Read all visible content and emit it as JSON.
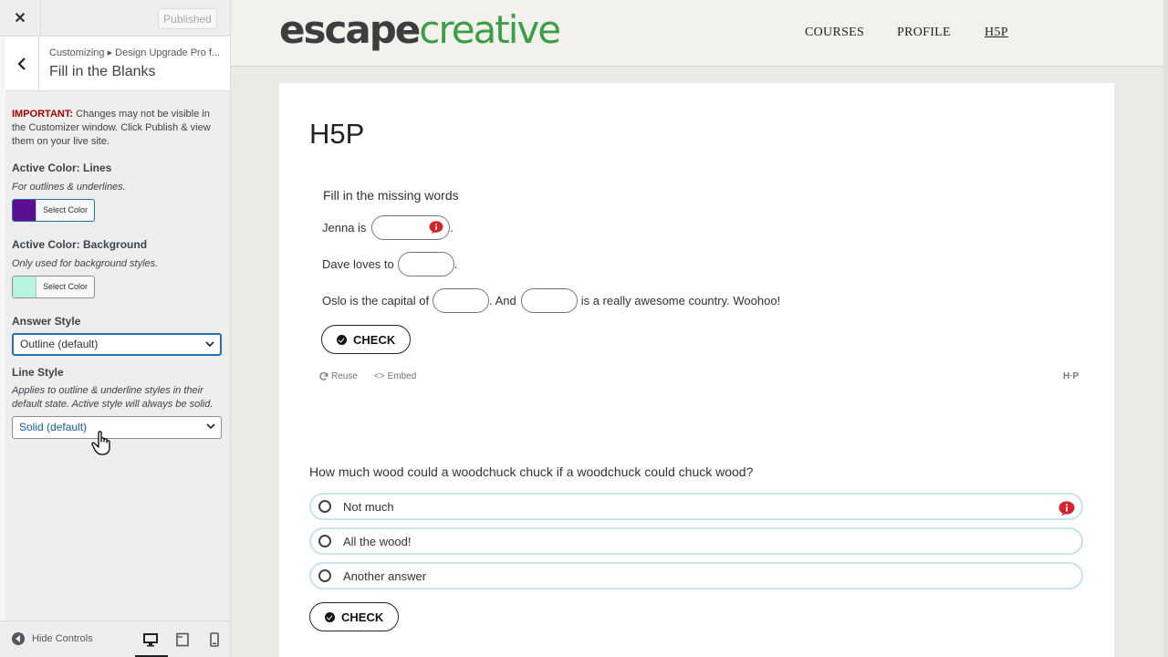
{
  "sidebar": {
    "close_icon": "close-icon",
    "published_label": "Published",
    "breadcrumb": "Customizing ▸ Design Upgrade Pro f...",
    "section_title": "Fill in the Blanks",
    "important_label": "IMPORTANT:",
    "important_text": " Changes may not be visible in the Customizer window. Click Publish & view them on your live site.",
    "lines_title": "Active Color: Lines",
    "lines_desc": "For outlines & underlines.",
    "lines_color": "#5b0e91",
    "select_color_label": "Select Color",
    "bg_title": "Active Color: Background",
    "bg_desc": "Only used for background styles.",
    "bg_color": "#b8f3e0",
    "answer_style_title": "Answer Style",
    "answer_style_value": "Outline (default)",
    "line_style_title": "Line Style",
    "line_style_desc": "Applies to outline & underline styles in their default state. Active style will always be solid.",
    "line_style_value": "Solid (default)",
    "hide_controls_label": "Hide Controls"
  },
  "site": {
    "logo_escape": "escape",
    "logo_creative": "creative",
    "nav": [
      "COURSES",
      "PROFILE",
      "H5P"
    ],
    "page_title": "H5P",
    "q1": {
      "intro": "Fill in the missing words",
      "line1_a": "Jenna is",
      "line1_b": ".",
      "line2_a": "Dave loves to",
      "line2_b": ".",
      "line3_a": "Oslo is the capital of",
      "line3_b": ". And",
      "line3_c": "is a really awesome country. Woohoo!",
      "check_label": "CHECK",
      "reuse_label": "Reuse",
      "embed_label": "Embed",
      "h5p_mark": "H·P"
    },
    "q2": {
      "question": "How much wood could a woodchuck chuck if a woodchuck could chuck wood?",
      "answers": [
        "Not much",
        "All the wood!",
        "Another answer"
      ],
      "check_label": "CHECK"
    },
    "colors": {
      "logo_green": "#3c9f45",
      "info_red": "#d2232a",
      "answer_border": "#c8e4ea"
    }
  }
}
